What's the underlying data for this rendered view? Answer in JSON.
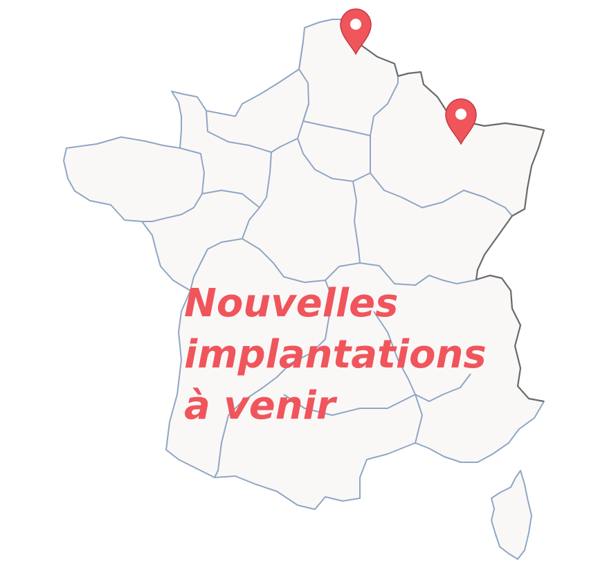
{
  "map": {
    "country": "France",
    "fill_color": "#faf8f7",
    "region_border_color": "#8ea6c4",
    "national_border_color": "#6b6b6b"
  },
  "markers": [
    {
      "icon": "map-pin-icon",
      "color": "#f0555c",
      "area": "Nord"
    },
    {
      "icon": "map-pin-icon",
      "color": "#f0555c",
      "area": "Lorraine"
    }
  ],
  "caption": {
    "line1": "Nouvelles",
    "line2": "implantations",
    "line3": "à venir",
    "color": "#f0555c"
  }
}
